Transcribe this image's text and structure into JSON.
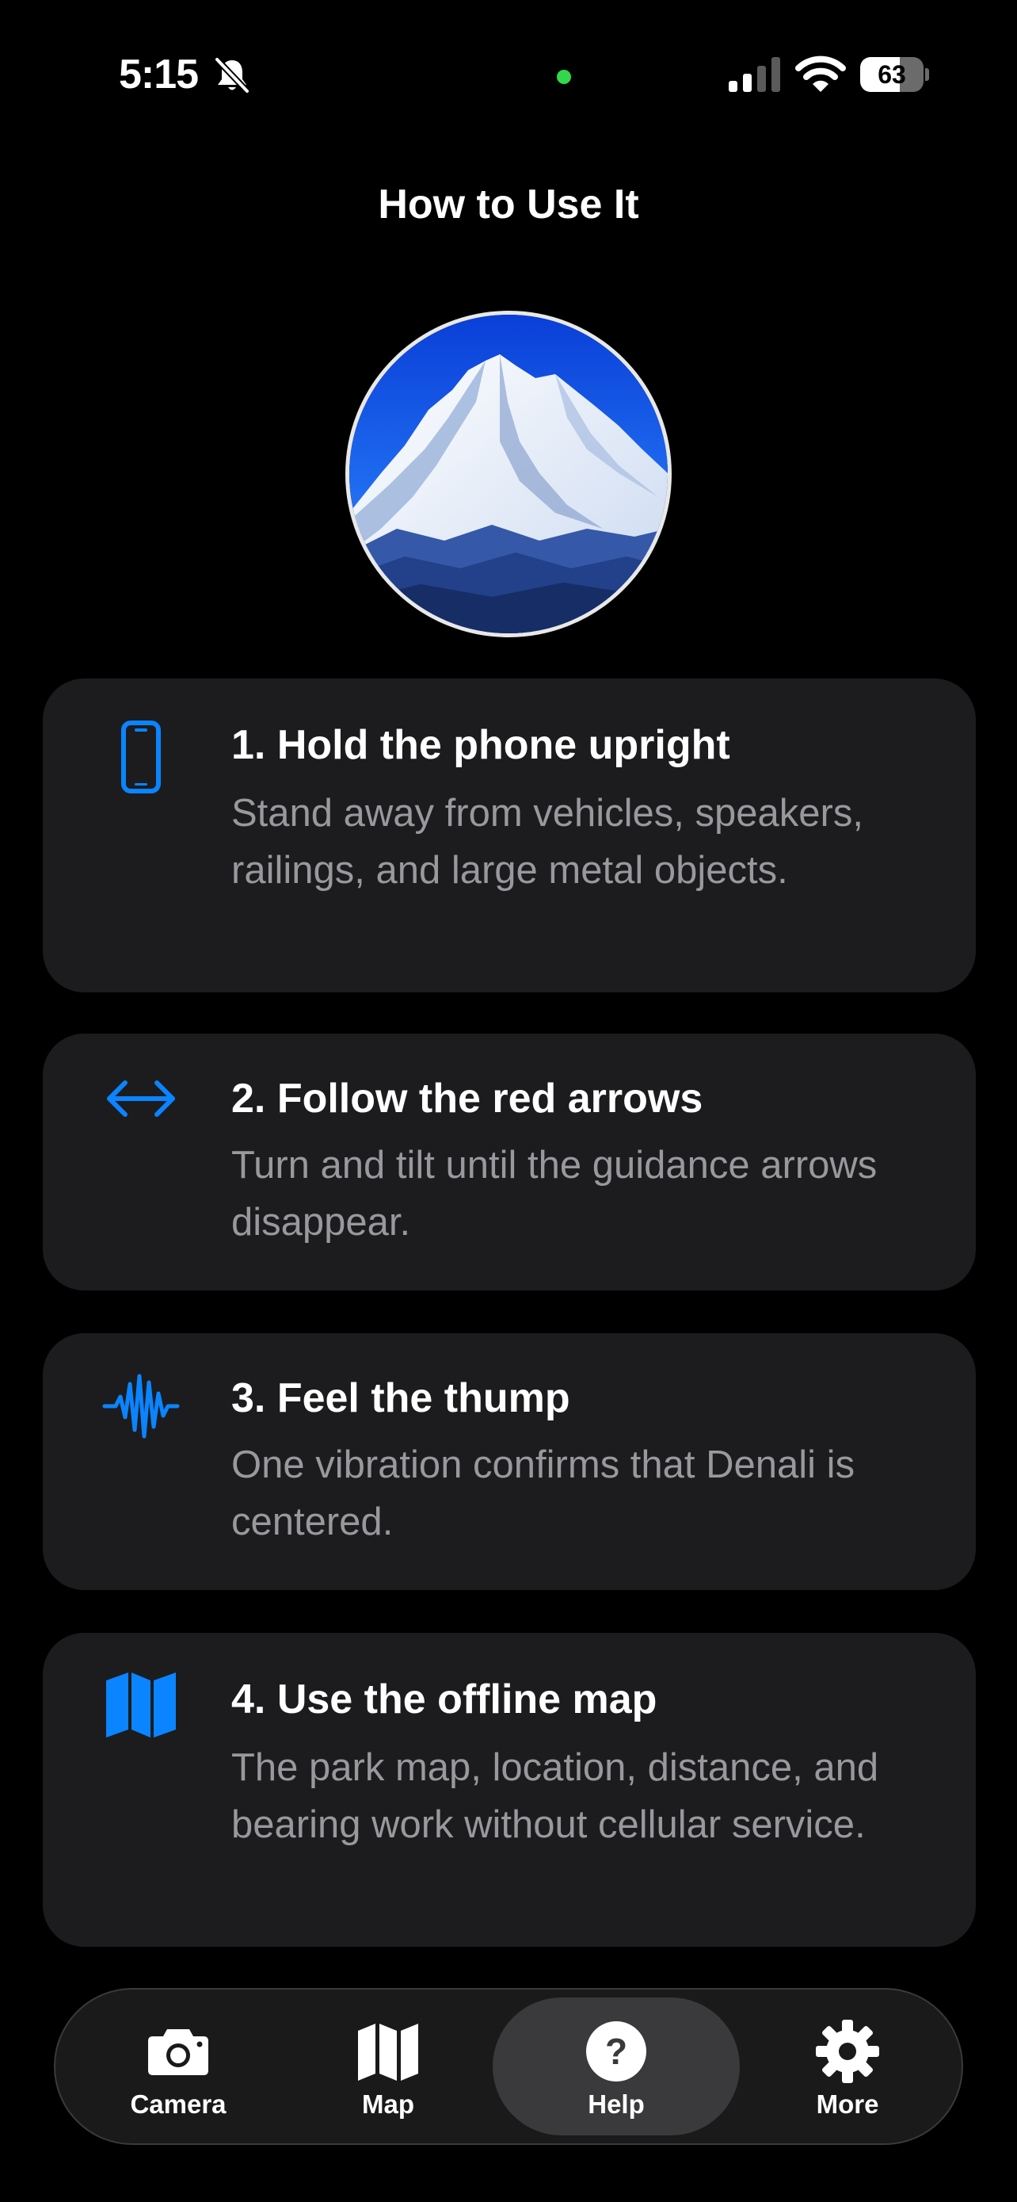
{
  "status_bar": {
    "time": "5:15",
    "battery": "63",
    "battery_level": 0.63
  },
  "page": {
    "title": "How to Use It"
  },
  "steps": [
    {
      "icon": "phone-icon",
      "title": "1. Hold the phone upright",
      "body": "Stand away from vehicles, speakers, railings, and large metal objects."
    },
    {
      "icon": "left-right-arrow-icon",
      "title": "2. Follow the red arrows",
      "body": "Turn and tilt until the guidance arrows disappear."
    },
    {
      "icon": "waveform-icon",
      "title": "3. Feel the thump",
      "body": "One vibration confirms that Denali is centered."
    },
    {
      "icon": "map-icon",
      "title": "4. Use the offline map",
      "body": "The park map, location, distance, and bearing work without cellular service."
    }
  ],
  "tabs": [
    {
      "label": "Camera",
      "icon": "camera-icon",
      "active": false
    },
    {
      "label": "Map",
      "icon": "map-icon",
      "active": false
    },
    {
      "label": "Help",
      "icon": "question-mark-icon",
      "active": true
    },
    {
      "label": "More",
      "icon": "gear-icon",
      "active": false
    }
  ],
  "colors": {
    "accent": "#0a84ff",
    "card_background": "#1c1c1e",
    "secondary_text": "#98989d",
    "privacy_indicator": "#32d74b"
  }
}
